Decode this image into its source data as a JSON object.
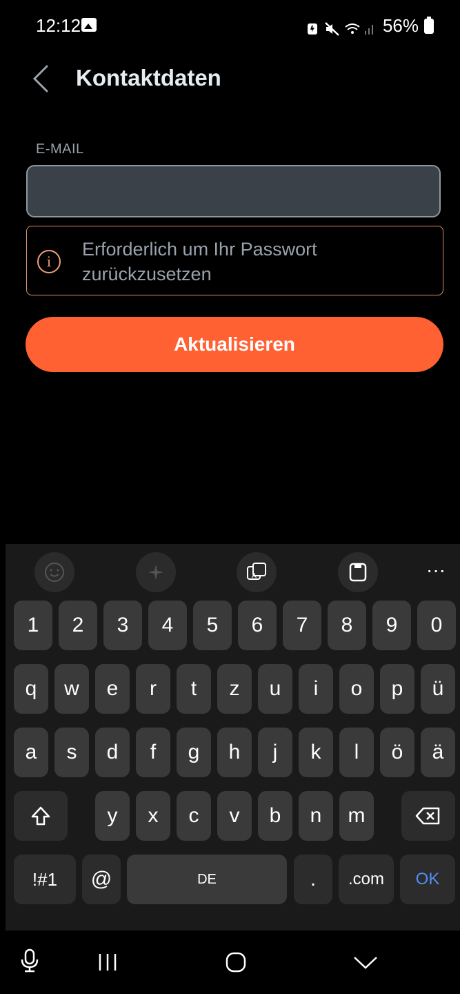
{
  "status": {
    "time": "12:12",
    "battery": "56%"
  },
  "header": {
    "title": "Kontaktdaten"
  },
  "form": {
    "email_label": "E-MAIL",
    "email_value": "",
    "hint": "Erforderlich um Ihr Passwort zurückzusetzen",
    "update_label": "Aktualisieren"
  },
  "keyboard": {
    "toolbar_more": "···",
    "row_numbers": [
      "1",
      "2",
      "3",
      "4",
      "5",
      "6",
      "7",
      "8",
      "9",
      "0"
    ],
    "row1": [
      "q",
      "w",
      "e",
      "r",
      "t",
      "z",
      "u",
      "i",
      "o",
      "p",
      "ü"
    ],
    "row2": [
      "a",
      "s",
      "d",
      "f",
      "g",
      "h",
      "j",
      "k",
      "l",
      "ö",
      "ä"
    ],
    "row3": [
      "y",
      "x",
      "c",
      "v",
      "b",
      "n",
      "m"
    ],
    "symbols": "!#1",
    "at": "@",
    "space": "DE",
    "period": ".",
    "dotcom": ".com",
    "ok": "OK"
  },
  "colors": {
    "accent": "#ff6133",
    "hint_border": "#d9936a",
    "ok_blue": "#4f8ff7"
  }
}
